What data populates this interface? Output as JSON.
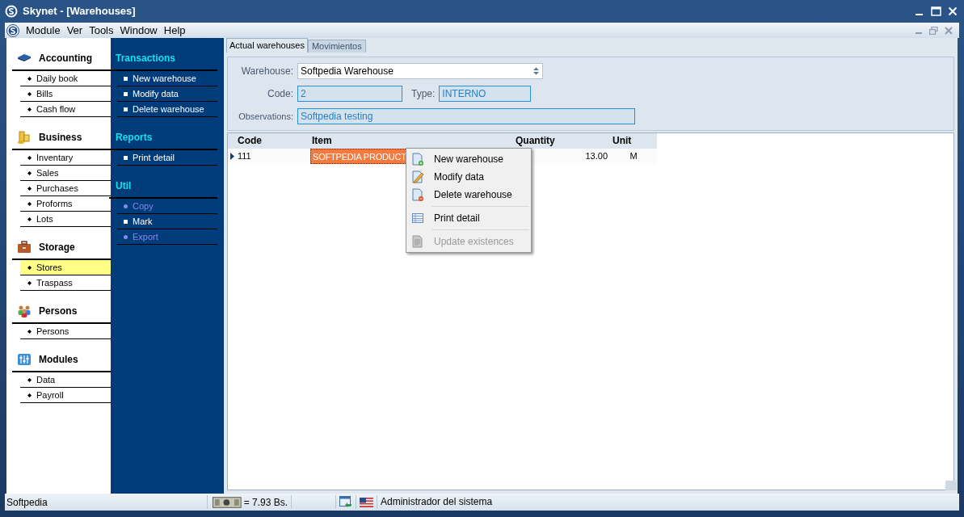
{
  "window": {
    "title": "Skynet - [Warehouses]"
  },
  "menu": [
    "Module",
    "Ver",
    "Tools",
    "Window",
    "Help"
  ],
  "nav_groups": [
    {
      "title": "Accounting",
      "kind": "book",
      "items": [
        {
          "label": "Daily book",
          "selected": false
        },
        {
          "label": "Bills",
          "selected": false
        },
        {
          "label": "Cash flow",
          "selected": false
        }
      ]
    },
    {
      "title": "Business",
      "kind": "coins",
      "items": [
        {
          "label": "Inventary",
          "selected": false
        },
        {
          "label": "Sales",
          "selected": false
        },
        {
          "label": "Purchases",
          "selected": false
        },
        {
          "label": "Proforms",
          "selected": false
        },
        {
          "label": "Lots",
          "selected": false
        }
      ]
    },
    {
      "title": "Storage",
      "kind": "case",
      "items": [
        {
          "label": "Stores",
          "selected": true
        },
        {
          "label": "Traspass",
          "selected": false
        }
      ]
    },
    {
      "title": "Persons",
      "kind": "people",
      "items": [
        {
          "label": "Persons",
          "selected": false
        }
      ]
    },
    {
      "title": "Modules",
      "kind": "modules",
      "items": [
        {
          "label": "Data",
          "selected": false
        },
        {
          "label": "Payroll",
          "selected": false
        }
      ]
    }
  ],
  "action_sections": [
    {
      "title": "Transactions",
      "items": [
        {
          "label": "New warehouse",
          "disabled": false
        },
        {
          "label": "Modify data",
          "disabled": false
        },
        {
          "label": "Delete warehouse",
          "disabled": false
        }
      ]
    },
    {
      "title": "Reports",
      "items": [
        {
          "label": "Print detail",
          "disabled": false
        }
      ]
    },
    {
      "title": "Util",
      "items": [
        {
          "label": "Copy",
          "disabled": true
        },
        {
          "label": "Mark",
          "disabled": false
        },
        {
          "label": "Export",
          "disabled": true
        }
      ]
    }
  ],
  "tabs": [
    {
      "label": "Actual warehouses",
      "selected": true
    },
    {
      "label": "Movimientos",
      "selected": false
    }
  ],
  "form": {
    "warehouse_label": "Warehouse:",
    "warehouse": "Softpedia Warehouse",
    "code_label": "Code:",
    "code": "2",
    "type_label": "Type:",
    "type": "INTERNO",
    "observations_label": "Observations:",
    "observations": "Softpedia testing"
  },
  "table": {
    "columns": [
      "Code",
      "Item",
      "Quantity",
      "Unit"
    ],
    "rows": [
      {
        "current": true,
        "cells": [
          {
            "text": "111",
            "selected": false
          },
          {
            "text": "SOFTPEDIA PRODUCT",
            "selected": true
          },
          {
            "text": "13.00",
            "selected": false
          },
          {
            "text": "M",
            "selected": false
          }
        ]
      }
    ]
  },
  "context_menu": [
    {
      "label": "New warehouse",
      "kind": "new",
      "disabled": false,
      "separator_before": false
    },
    {
      "label": "Modify data",
      "kind": "edit",
      "disabled": false,
      "separator_before": false
    },
    {
      "label": "Delete warehouse",
      "kind": "delete",
      "disabled": false,
      "separator_before": false
    },
    {
      "label": "Print detail",
      "kind": "print",
      "disabled": false,
      "separator_before": true
    },
    {
      "label": "Update existences",
      "kind": "update",
      "disabled": true,
      "separator_before": true
    }
  ],
  "status_bar": {
    "left": "Softpedia",
    "rate": "= 7.93 Bs.",
    "user": "Administrador del sistema"
  }
}
